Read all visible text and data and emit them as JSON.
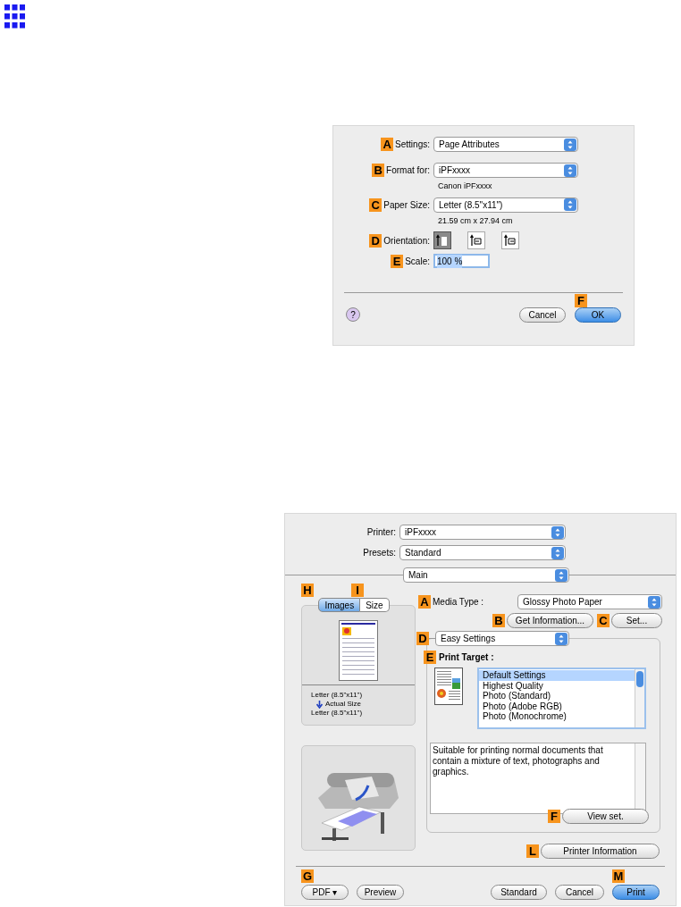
{
  "page_setup": {
    "rows": [
      {
        "kind": "select",
        "marker": "A",
        "label": "Settings:",
        "value": "Page Attributes"
      },
      {
        "kind": "select",
        "marker": "B",
        "label": "Format for:",
        "value": "iPFxxxx",
        "note": "Canon iPFxxxx"
      },
      {
        "kind": "select",
        "marker": "C",
        "label": "Paper Size:",
        "value": "Letter (8.5\"x11\")",
        "note": "21.59 cm x 27.94 cm"
      },
      {
        "kind": "orientation",
        "marker": "D",
        "label": "Orientation:",
        "options": [
          {
            "kind": "portrait",
            "selected": true
          },
          {
            "kind": "landscape",
            "selected": false
          },
          {
            "kind": "landscape-reverse",
            "selected": false
          }
        ]
      },
      {
        "kind": "input",
        "marker": "E",
        "label": "Scale:",
        "value": "100 %"
      }
    ],
    "help": "?",
    "buttons": [
      {
        "label": "Cancel",
        "default": false
      },
      {
        "label": "OK",
        "default": true,
        "marker": "F"
      }
    ]
  },
  "print": {
    "printer": {
      "label": "Printer:",
      "value": "iPFxxxx"
    },
    "presets": {
      "label": "Presets:",
      "value": "Standard"
    },
    "panel": "Main",
    "tabs": [
      {
        "marker": "H",
        "label": "Images",
        "selected": true
      },
      {
        "marker": "I",
        "label": "Size",
        "selected": false
      }
    ],
    "size_info": {
      "from": "Letter (8.5\"x11\")",
      "scaling": "Actual Size",
      "to": "Letter (8.5\"x11\")"
    },
    "media_type": {
      "marker": "A",
      "label": "Media Type :",
      "value": "Glossy Photo Paper"
    },
    "get_information": {
      "marker": "B",
      "label": "Get Information..."
    },
    "set": {
      "marker": "C",
      "label": "Set..."
    },
    "mode": {
      "marker": "D",
      "value": "Easy Settings"
    },
    "print_target": {
      "marker": "E",
      "label": "Print Target :",
      "items": [
        {
          "label": "Default Settings",
          "selected": true
        },
        {
          "label": "Highest Quality",
          "selected": false
        },
        {
          "label": "Photo (Standard)",
          "selected": false
        },
        {
          "label": "Photo (Adobe RGB)",
          "selected": false
        },
        {
          "label": "Photo (Monochrome)",
          "selected": false
        }
      ]
    },
    "description": "Suitable for printing normal documents that contain a mixture of text, photographs and graphics.",
    "view_set": {
      "marker": "F",
      "label": "View set."
    },
    "printer_information": {
      "marker": "L",
      "label": "Printer Information"
    },
    "footer_marker": "G",
    "footer_buttons": [
      {
        "label": "PDF ▾",
        "default": false
      },
      {
        "label": "Preview",
        "default": false
      },
      {
        "label": "Standard",
        "default": false
      },
      {
        "label": "Cancel",
        "default": false
      },
      {
        "label": "Print",
        "default": true,
        "marker": "M"
      }
    ]
  }
}
